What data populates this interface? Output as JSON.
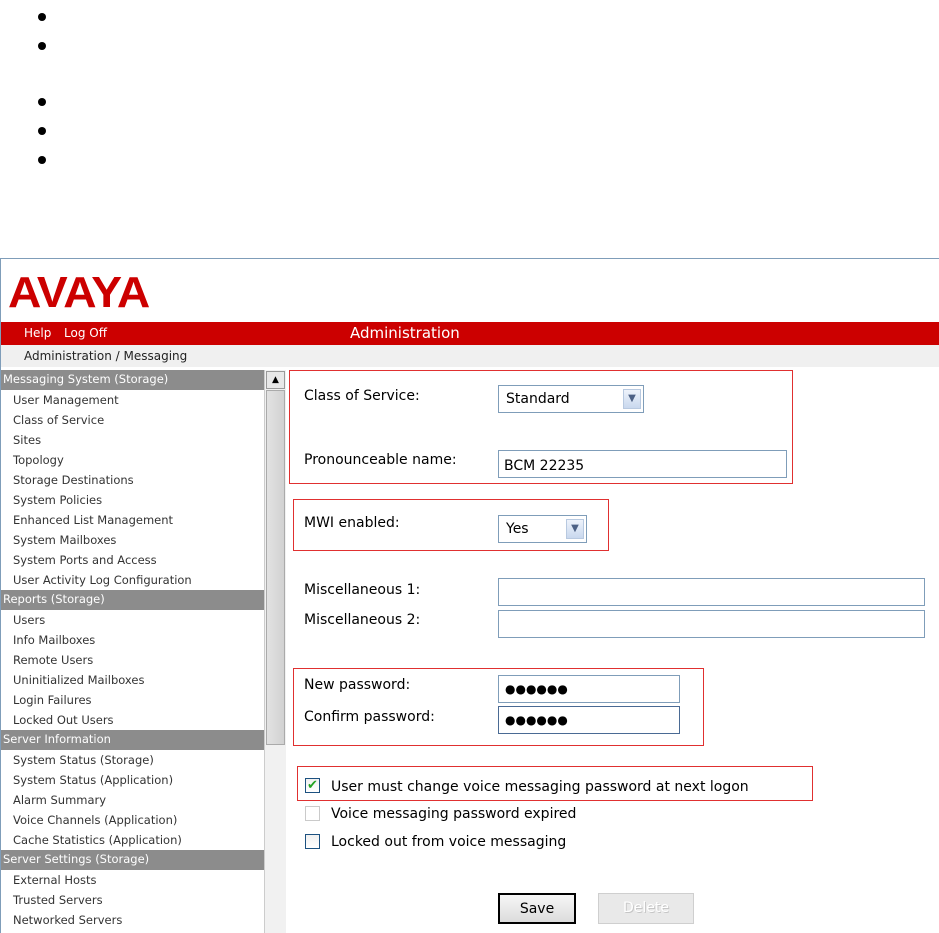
{
  "app": {
    "logo_text": "AVAYA",
    "brand_color": "#cc0000"
  },
  "header": {
    "help_label": "Help",
    "logoff_label": "Log Off",
    "title": "Administration"
  },
  "breadcrumb": "Administration / Messaging",
  "sidebar": {
    "sections": [
      {
        "label": "Messaging System (Storage)",
        "items": [
          "User Management",
          "Class of Service",
          "Sites",
          "Topology",
          "Storage Destinations",
          "System Policies",
          "Enhanced List Management",
          "System Mailboxes",
          "System Ports and Access",
          "User Activity Log Configuration"
        ]
      },
      {
        "label": "Reports (Storage)",
        "items": [
          "Users",
          "Info Mailboxes",
          "Remote Users",
          "Uninitialized Mailboxes",
          "Login Failures",
          "Locked Out Users"
        ]
      },
      {
        "label": "Server Information",
        "items": [
          "System Status (Storage)",
          "System Status (Application)",
          "Alarm Summary",
          "Voice Channels (Application)",
          "Cache Statistics (Application)"
        ]
      },
      {
        "label": "Server Settings (Storage)",
        "items": [
          "External Hosts",
          "Trusted Servers",
          "Networked Servers"
        ]
      }
    ]
  },
  "form": {
    "class_of_service_label": "Class of Service:",
    "class_of_service_value": "Standard",
    "pronounceable_name_label": "Pronounceable name:",
    "pronounceable_name_value": "BCM 22235",
    "mwi_label": "MWI enabled:",
    "mwi_value": "Yes",
    "misc1_label": "Miscellaneous 1:",
    "misc1_value": "",
    "misc2_label": "Miscellaneous 2:",
    "misc2_value": "",
    "new_password_label": "New password:",
    "new_password_value": "●●●●●●",
    "confirm_password_label": "Confirm password:",
    "confirm_password_value": "●●●●●●",
    "must_change_label": "User must change voice messaging password at next logon",
    "must_change_checked": true,
    "expired_label": "Voice messaging password expired",
    "expired_checked": false,
    "locked_out_label": "Locked out from voice messaging",
    "locked_out_checked": false
  },
  "buttons": {
    "save": "Save",
    "delete": "Delete"
  },
  "icons": {
    "scroll_up": "scroll-up-arrow-icon",
    "dropdown": "chevron-down-icon",
    "checkmark": "checkmark-icon"
  }
}
